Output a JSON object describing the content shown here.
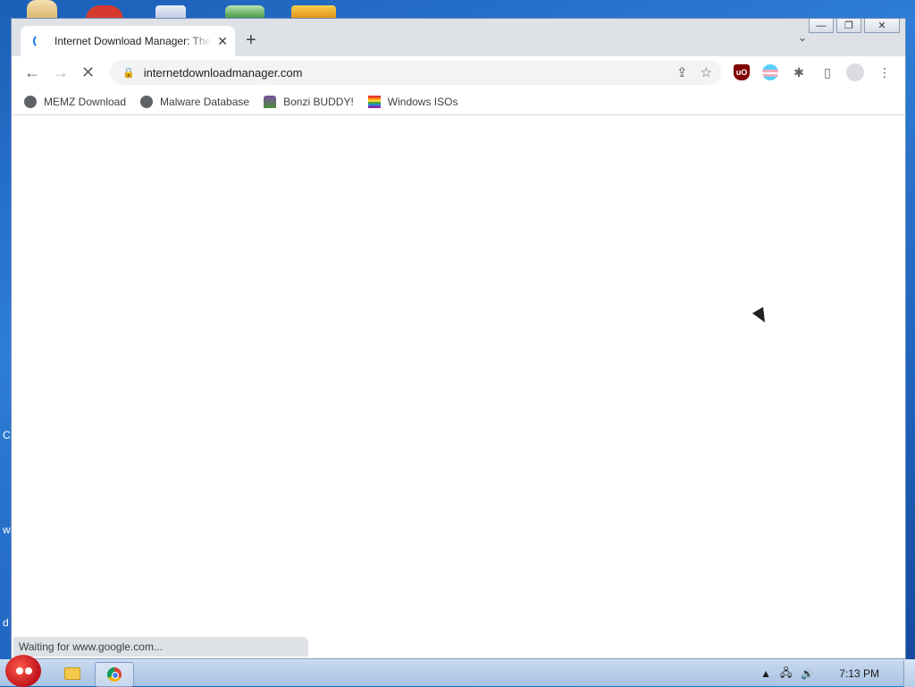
{
  "window": {
    "tab_title": "Internet Download Manager: The",
    "tab_close": "✕",
    "new_tab": "+",
    "tab_search": "⌄",
    "controls": {
      "minimize": "—",
      "restore": "❐",
      "close": "✕"
    }
  },
  "toolbar": {
    "back": "←",
    "forward": "→",
    "stop": "✕",
    "url": "internetdownloadmanager.com",
    "share": "⇪",
    "bookmark_star": "☆",
    "ublock_label": "uO",
    "puzzle": "✱",
    "sidepanel": "▯",
    "menu": "⋮"
  },
  "bookmarks": [
    {
      "label": "MEMZ Download",
      "icon": "globe-icon"
    },
    {
      "label": "Malware Database",
      "icon": "globe-icon"
    },
    {
      "label": "Bonzi BUDDY!",
      "icon": "bonzi-icon"
    },
    {
      "label": "Windows ISOs",
      "icon": "rainbow-flag-icon"
    }
  ],
  "status_text": "Waiting for www.google.com...",
  "taskbar": {
    "clock": "7:13 PM",
    "tray_up": "▲",
    "volume": "🔊"
  },
  "desktop_edge_letters": [
    "C",
    "w",
    "d"
  ]
}
